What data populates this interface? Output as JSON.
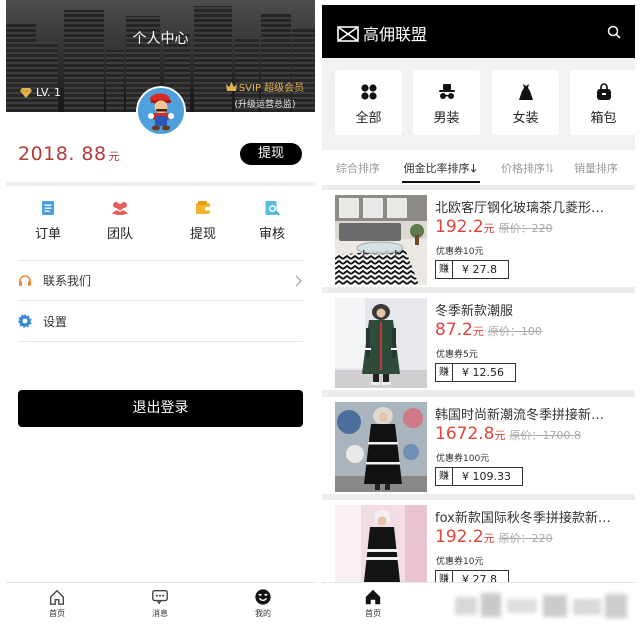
{
  "left": {
    "header": {
      "title": "个人中心",
      "level": "LV. 1",
      "vip_badge": "SVIP 超级会员",
      "vip_sub": "(升级运营总监)"
    },
    "balance": {
      "amount": "2018. 88",
      "unit": "元",
      "withdraw_label": "提现"
    },
    "shortcuts": [
      {
        "label": "订单",
        "icon": "order-icon"
      },
      {
        "label": "团队",
        "icon": "team-icon"
      },
      {
        "label": "提现",
        "icon": "wallet-icon"
      },
      {
        "label": "审核",
        "icon": "review-icon"
      }
    ],
    "menu": [
      {
        "label": "联系我们",
        "icon": "headset-icon"
      },
      {
        "label": "设置",
        "icon": "gear-icon"
      }
    ],
    "logout_label": "退出登录",
    "tabbar": [
      {
        "label": "首页",
        "icon": "home-icon"
      },
      {
        "label": "消息",
        "icon": "message-icon"
      },
      {
        "label": "我的",
        "icon": "profile-icon",
        "active": true
      }
    ]
  },
  "right": {
    "header": {
      "title": "高佣联盟",
      "logo_icon": "bowtie-logo-icon",
      "search_icon": "search-icon"
    },
    "categories": [
      {
        "label": "全部",
        "icon": "grid-icon"
      },
      {
        "label": "男装",
        "icon": "menswear-icon"
      },
      {
        "label": "女装",
        "icon": "dress-icon"
      },
      {
        "label": "箱包",
        "icon": "bag-icon"
      }
    ],
    "sort_tabs": [
      {
        "label": "综合排序"
      },
      {
        "label": "佣金比率排序",
        "active": true,
        "icon": "sort-desc-icon"
      },
      {
        "label": "价格排序",
        "icon": "sort-toggle-icon"
      },
      {
        "label": "销量排序"
      }
    ],
    "products": [
      {
        "title": "北欧客厅钢化玻璃茶几菱形…",
        "price": "192.2",
        "unit": "元",
        "original_price": "原价：220",
        "coupon": "优惠券10元",
        "earn_label": "赚",
        "earn_amount": "¥ 27.8"
      },
      {
        "title": "冬季新款潮服",
        "price": "87.2",
        "unit": "元",
        "original_price": "原价：100",
        "coupon": "优惠券5元",
        "earn_label": "赚",
        "earn_amount": "¥ 12.56"
      },
      {
        "title": "韩国时尚新潮流冬季拼接新…",
        "price": "1672.8",
        "unit": "元",
        "original_price": "原价：1700.8",
        "coupon": "优惠券100元",
        "earn_label": "赚",
        "earn_amount": "¥ 109.33"
      },
      {
        "title": "fox新款国际秋冬季拼接款新…",
        "price": "192.2",
        "unit": "元",
        "original_price": "原价：220",
        "coupon": "优惠券10元",
        "earn_label": "赚",
        "earn_amount": "¥ 27.8"
      }
    ],
    "tabbar": [
      {
        "label": "首页",
        "icon": "home-icon",
        "active": true
      }
    ]
  },
  "colors": {
    "price_red": "#e0443a",
    "balance_red": "#b23c37",
    "gold": "#e2b24e",
    "primary_black": "#000000"
  }
}
